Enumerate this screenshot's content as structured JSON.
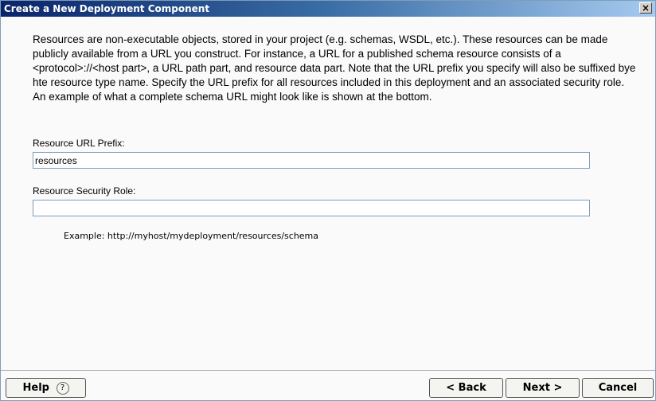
{
  "window": {
    "title": "Create a New Deployment Component",
    "close_label": "×"
  },
  "description": "Resources are non-executable objects, stored in your project (e.g. schemas, WSDL, etc.).  These resources can be made publicly available from a URL you construct.  For instance, a URL for a published schema resource consists of a <protocol>://<host part>, a URL path part, and resource data part.  Note that the URL prefix you specify will also be suffixed bye hte resource type name.  Specify the URL prefix for all resources included in this deployment and an associated security role.  An example of what a complete schema URL might look like is shown at the bottom.",
  "form": {
    "url_prefix_label": "Resource URL Prefix:",
    "url_prefix_value": "resources",
    "security_role_label": "Resource Security Role:",
    "security_role_value": ""
  },
  "example": "Example: http://myhost/mydeployment/resources/schema",
  "buttons": {
    "help": "Help",
    "help_icon": "?",
    "back": "< Back",
    "next": "Next >",
    "cancel": "Cancel"
  }
}
